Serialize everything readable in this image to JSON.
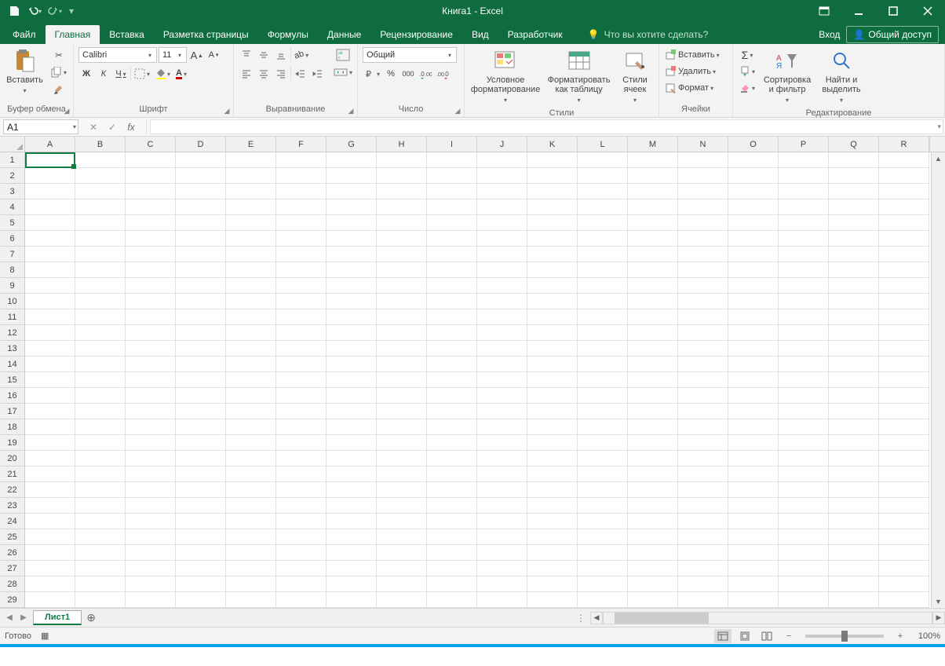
{
  "title": "Книга1 - Excel",
  "qat": {
    "save": "save-icon",
    "undo": "undo-icon",
    "redo": "redo-icon"
  },
  "tabs": {
    "file": "Файл",
    "items": [
      "Главная",
      "Вставка",
      "Разметка страницы",
      "Формулы",
      "Данные",
      "Рецензирование",
      "Вид",
      "Разработчик"
    ],
    "active": "Главная",
    "tell_me": "Что вы хотите сделать?",
    "login": "Вход",
    "share": "Общий доступ"
  },
  "ribbon": {
    "clipboard": {
      "paste": "Вставить",
      "label": "Буфер обмена"
    },
    "font": {
      "name": "Calibri",
      "size": "11",
      "bold": "Ж",
      "italic": "К",
      "underline": "Ч",
      "label": "Шрифт"
    },
    "alignment": {
      "label": "Выравнивание",
      "wrap": "wrap-icon",
      "merge": "merge-icon"
    },
    "number": {
      "format": "Общий",
      "label": "Число",
      "currency": "₽",
      "percent": "%",
      "comma": "000"
    },
    "styles": {
      "conditional": "Условное форматирование",
      "table": "Форматировать как таблицу",
      "cell_styles": "Стили ячеек",
      "label": "Стили"
    },
    "cells": {
      "insert": "Вставить",
      "delete": "Удалить",
      "format": "Формат",
      "label": "Ячейки"
    },
    "editing": {
      "sort": "Сортировка и фильтр",
      "find": "Найти и выделить",
      "label": "Редактирование"
    }
  },
  "formula_bar": {
    "name_box": "A1",
    "formula": ""
  },
  "grid": {
    "columns": [
      "A",
      "B",
      "C",
      "D",
      "E",
      "F",
      "G",
      "H",
      "I",
      "J",
      "K",
      "L",
      "M",
      "N",
      "O",
      "P",
      "Q",
      "R"
    ],
    "rows": [
      1,
      2,
      3,
      4,
      5,
      6,
      7,
      8,
      9,
      10,
      11,
      12,
      13,
      14,
      15,
      16,
      17,
      18,
      19,
      20,
      21,
      22,
      23,
      24,
      25,
      26,
      27,
      28,
      29
    ],
    "selected": "A1"
  },
  "sheets": {
    "tabs": [
      "Лист1"
    ],
    "active": "Лист1"
  },
  "status": {
    "ready": "Готово",
    "zoom": "100%"
  }
}
